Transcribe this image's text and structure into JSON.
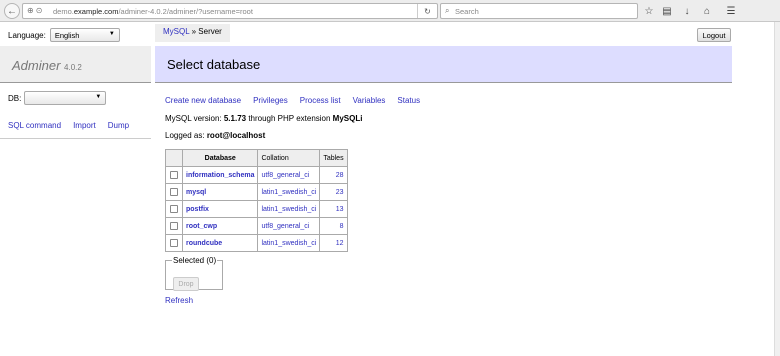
{
  "browser": {
    "url_prefix": "demo.",
    "url_host": "example.com",
    "url_path": "/adminer-4.0.2/adminer/?username=root",
    "search_placeholder": "Search"
  },
  "language": {
    "label": "Language:",
    "selected": "English"
  },
  "breadcrumb": {
    "link": "MySQL",
    "separator": " » ",
    "current": "Server"
  },
  "logout_label": "Logout",
  "brand": {
    "name": "Adminer",
    "version": "4.0.2"
  },
  "page_title": "Select database",
  "db_selector": {
    "label": "DB:",
    "selected": ""
  },
  "side_links": [
    "SQL command",
    "Import",
    "Dump"
  ],
  "menu_links": [
    "Create new database",
    "Privileges",
    "Process list",
    "Variables",
    "Status"
  ],
  "info": {
    "version_prefix": "MySQL version: ",
    "version": "5.1.73",
    "version_mid": " through PHP extension ",
    "extension": "MySQLi",
    "logged_prefix": "Logged as: ",
    "logged_user": "root@localhost"
  },
  "table": {
    "headers": [
      "Database",
      "Collation",
      "Tables"
    ],
    "rows": [
      {
        "name": "information_schema",
        "collation": "utf8_general_ci",
        "tables": "28"
      },
      {
        "name": "mysql",
        "collation": "latin1_swedish_ci",
        "tables": "23"
      },
      {
        "name": "postfix",
        "collation": "latin1_swedish_ci",
        "tables": "13"
      },
      {
        "name": "root_cwp",
        "collation": "utf8_general_ci",
        "tables": "8"
      },
      {
        "name": "roundcube",
        "collation": "latin1_swedish_ci",
        "tables": "12"
      }
    ]
  },
  "selected_legend": "Selected (0)",
  "drop_label": "Drop",
  "refresh_label": "Refresh",
  "icons": {
    "back": "back-arrow-icon",
    "site": "site-identity-icon",
    "reload": "reload-icon",
    "search": "search-icon",
    "bookmark": "bookmark-star-icon",
    "library": "library-icon",
    "downloads": "download-icon",
    "home": "home-icon",
    "menu": "hamburger-menu-icon"
  },
  "colors": {
    "link": "#3030c0",
    "header_bg": "#ddf",
    "sidebar_bg": "#eeeeee"
  }
}
